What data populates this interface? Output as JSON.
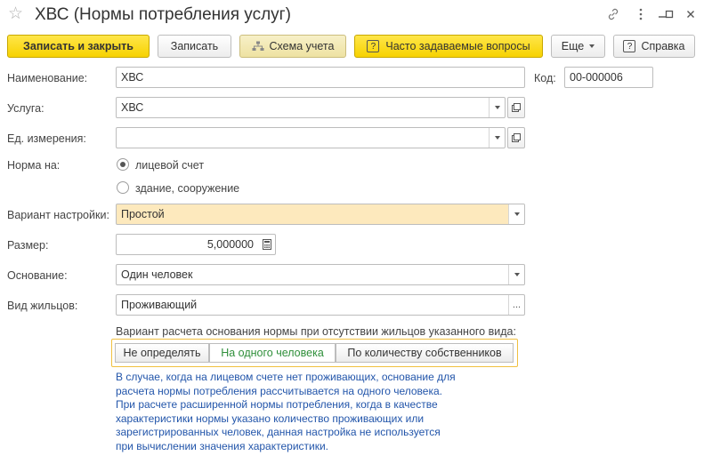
{
  "window": {
    "title": "ХВС (Нормы потребления услуг)"
  },
  "toolbar": {
    "save_close": "Записать и закрыть",
    "save": "Записать",
    "schema": "Схема учета",
    "faq_icon": "?",
    "faq": "Часто задаваемые вопросы",
    "more": "Еще",
    "help_icon": "?",
    "help": "Справка"
  },
  "form": {
    "name_label": "Наименование:",
    "name_value": "ХВС",
    "code_label": "Код:",
    "code_value": "00-000006",
    "service_label": "Услуга:",
    "service_value": "ХВС",
    "unit_label": "Ед. измерения:",
    "unit_value": "",
    "norm_label": "Норма на:",
    "norm_options": [
      "лицевой счет",
      "здание, сооружение"
    ],
    "norm_selected": 0,
    "variant_label": "Вариант настройки:",
    "variant_value": "Простой",
    "size_label": "Размер:",
    "size_value": "5,000000",
    "basis_label": "Основание:",
    "basis_value": "Один человек",
    "residents_label": "Вид жильцов:",
    "residents_value": "Проживающий",
    "calc_caption": "Вариант расчета основания нормы при отсутствии жильцов указанного вида:",
    "calc_options": [
      "Не определять",
      "На одного человека",
      "По количеству собственников"
    ],
    "calc_selected": 1,
    "info_lines": [
      "В случае, когда на лицевом счете нет проживающих, основание для",
      "расчета нормы потребления рассчитывается на одного человека.",
      "При расчете расширенной нормы потребления, когда в качестве",
      "характеристики нормы указано количество проживающих или",
      "зарегистрированных человек, данная настройка не используется",
      "при вычислении значения характеристики."
    ]
  },
  "colors": {
    "accent_yellow": "#f7d200",
    "highlight_field": "#fde9bd",
    "active_segment_text": "#2f8f3a",
    "info_text": "#2255aa"
  }
}
